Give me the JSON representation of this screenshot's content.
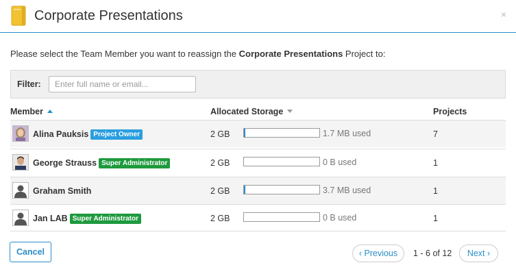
{
  "dialog": {
    "title": "Corporate Presentations",
    "close_glyph": "×",
    "instruction_prefix": "Please select the Team Member you want to reassign the ",
    "instruction_project": "Corporate Presentations",
    "instruction_suffix": " Project to:"
  },
  "filter": {
    "label": "Filter:",
    "placeholder": "Enter full name or email..."
  },
  "table": {
    "headers": {
      "member": "Member",
      "storage": "Allocated Storage",
      "projects": "Projects"
    },
    "rows": [
      {
        "name": "Alina Pauksis",
        "badge": "Project Owner",
        "badge_type": "owner",
        "avatar": "photo-avatar-woman",
        "allocated": "2 GB",
        "used": "1.7 MB used",
        "used_fraction": 0.01,
        "projects": "7"
      },
      {
        "name": "George Strauss",
        "badge": "Super Administrator",
        "badge_type": "admin",
        "avatar": "photo-avatar-man",
        "allocated": "2 GB",
        "used": "0 B used",
        "used_fraction": 0.0,
        "projects": "1"
      },
      {
        "name": "Graham Smith",
        "badge": "",
        "badge_type": "",
        "avatar": "default-avatar",
        "allocated": "2 GB",
        "used": "3.7 MB used",
        "used_fraction": 0.01,
        "projects": "1"
      },
      {
        "name": "Jan LAB",
        "badge": "Super Administrator",
        "badge_type": "admin",
        "avatar": "default-avatar",
        "allocated": "2 GB",
        "used": "0 B used",
        "used_fraction": 0.0,
        "projects": "1"
      }
    ]
  },
  "footer": {
    "cancel": "Cancel",
    "previous": "‹ Previous",
    "page_info": "1 - 6 of 12",
    "next": "Next ›"
  },
  "colors": {
    "accent": "#2a8ec8",
    "owner_badge": "#2a9ee0",
    "admin_badge": "#1e9a3e",
    "folder": "#f2c232"
  }
}
